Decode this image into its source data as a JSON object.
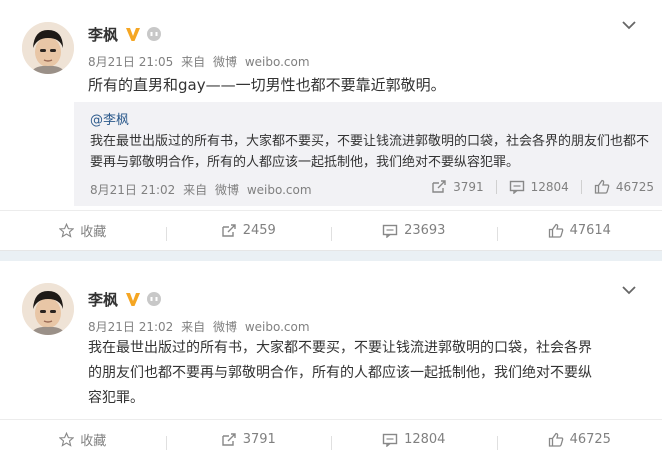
{
  "posts": [
    {
      "author": "李枫",
      "date": "8月21日 21:05",
      "source_prefix": "来自",
      "source": "微博",
      "source_site": "weibo.com",
      "text": "所有的直男和gay——一切男性也都不要靠近郭敬明。",
      "repost": {
        "mention": "@李枫",
        "text": "我在最世出版过的所有书，大家都不要买，不要让钱流进郭敬明的口袋，社会各界的朋友们也都不要再与郭敬明合作，所有的人都应该一起抵制他，我们绝对不要纵容犯罪。",
        "date": "8月21日 21:02",
        "source_prefix": "来自",
        "source": "微博",
        "source_site": "weibo.com",
        "reposts": "3791",
        "comments": "12804",
        "likes": "46725"
      },
      "actions": {
        "favorite": "收藏",
        "reposts": "2459",
        "comments": "23693",
        "likes": "47614"
      }
    },
    {
      "author": "李枫",
      "date": "8月21日 21:02",
      "source_prefix": "来自",
      "source": "微博",
      "source_site": "weibo.com",
      "text_lines": [
        "我在最世出版过的所有书，大家都不要买，不要让钱流进郭敬明的口袋，社会各界",
        "的朋友们也都不要再与郭敬明合作，所有的人都应该一起抵制他，我们绝对不要纵",
        "容犯罪。"
      ],
      "actions": {
        "favorite": "收藏",
        "reposts": "3791",
        "comments": "12804",
        "likes": "46725"
      }
    }
  ],
  "colors": {
    "badge": "#f5a623",
    "link": "#2c5a8c",
    "muted": "#808080",
    "gap": "#eaf0f4",
    "repost_bg": "#f2f2f5"
  },
  "icons": {
    "verified": "verified-v-icon",
    "level": "member-level-icon",
    "menu": "chevron-down-icon",
    "favorite": "star-icon",
    "repost": "share-icon",
    "comment": "comment-icon",
    "like": "thumbs-up-icon"
  }
}
